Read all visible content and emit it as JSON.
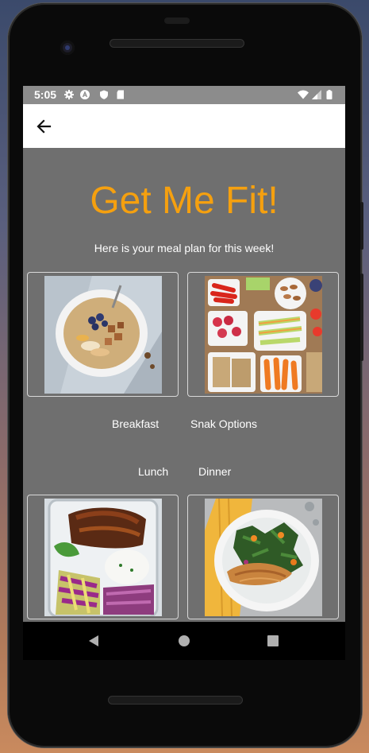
{
  "status_bar": {
    "time": "5:05",
    "left_icons": [
      "gear-icon",
      "a-circle-icon",
      "shield-icon",
      "sd-card-icon"
    ],
    "right_icons": [
      "wifi-icon",
      "signal-icon",
      "battery-icon"
    ]
  },
  "app_bar": {
    "back_icon": "arrow-left-icon"
  },
  "main": {
    "title": "Get Me Fit!",
    "subtitle": "Here is your meal plan for this week!",
    "meals": [
      {
        "label": "Breakfast",
        "image": "oatmeal-bowl"
      },
      {
        "label": "Snak Options",
        "image": "snack-tray"
      },
      {
        "label": "Lunch",
        "image": "chicken-rice-box"
      },
      {
        "label": "Dinner",
        "image": "fish-salad-plate"
      }
    ]
  },
  "nav_bar": {
    "icons": [
      "back-triangle-icon",
      "home-circle-icon",
      "overview-square-icon"
    ]
  },
  "colors": {
    "background": "#6f6f6f",
    "title": "#f5a00f",
    "status_bar": "#8c8c8c",
    "app_bar": "#ffffff"
  }
}
